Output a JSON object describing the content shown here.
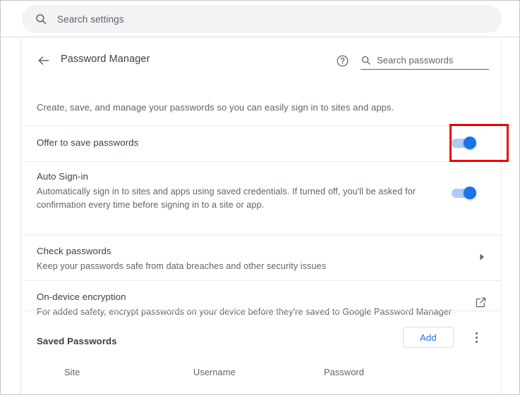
{
  "topbar": {
    "search_placeholder": "Search settings",
    "search_value": "",
    "search_icon": "search-icon"
  },
  "header": {
    "back_icon": "back-arrow-icon",
    "title": "Password Manager",
    "help_icon": "help-circle-icon",
    "search_icon": "search-icon",
    "search_placeholder": "Search passwords",
    "search_value": ""
  },
  "description": "Create, save, and manage your passwords so you can easily sign in to sites and apps.",
  "rows": [
    {
      "title": "Offer to save passwords",
      "subtitle": "",
      "control": "toggle",
      "toggle_on": true,
      "highlighted": true
    },
    {
      "title": "Auto Sign-in",
      "subtitle": "Automatically sign in to sites and apps using saved credentials. If turned off, you'll be asked for confirmation every time before signing in to a site or app.",
      "control": "toggle",
      "toggle_on": true,
      "highlighted": false
    },
    {
      "title": "Check passwords",
      "subtitle": "Keep your passwords safe from data breaches and other security issues",
      "control": "chevron",
      "chevron_icon": "chevron-right-icon",
      "highlighted": false
    },
    {
      "title": "On-device encryption",
      "subtitle": "For added safety, encrypt passwords on your device before they're saved to Google Password Manager",
      "control": "external",
      "external_icon": "external-link-icon",
      "highlighted": false
    }
  ],
  "saved_passwords": {
    "title": "Saved Passwords",
    "add_label": "Add",
    "more_icon": "kebab-menu-icon",
    "columns": [
      "Site",
      "Username",
      "Password"
    ],
    "rows": []
  },
  "colors": {
    "accent": "#1a73e8",
    "toggle_track": "#aecbfa",
    "highlight": "#ef0000",
    "text_primary": "#3c4043",
    "text_secondary": "#5f6368",
    "divider": "#e8eaed",
    "search_bg": "#f1f3f4"
  }
}
